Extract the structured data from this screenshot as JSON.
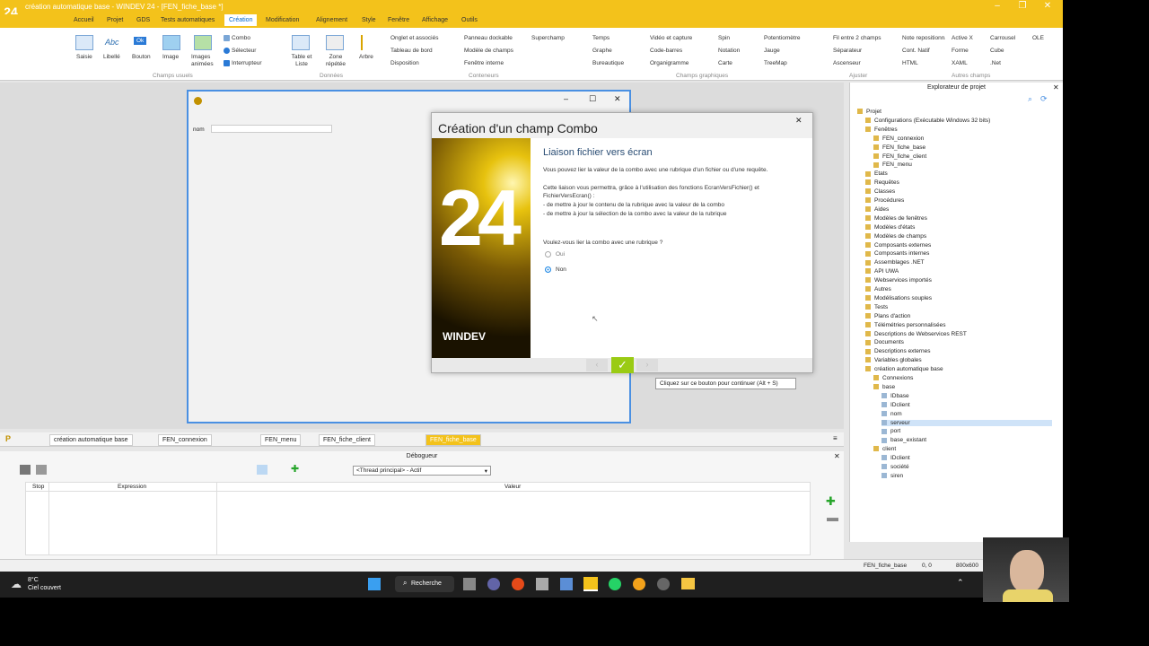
{
  "titlebar": {
    "logo": "24",
    "title": "création automatique base - WINDEV 24 - [FEN_fiche_base *]"
  },
  "menu": [
    "Accueil",
    "Projet",
    "GDS",
    "Tests automatiques",
    "Création",
    "Modification",
    "Alignement",
    "Style",
    "Fenêtre",
    "Affichage",
    "Outils"
  ],
  "menu_active_index": 4,
  "ribbon": {
    "usual": {
      "saisie": "Saisie",
      "libelle": "Libellé",
      "bouton": "Bouton",
      "image": "Image",
      "images_animees": "Images animées",
      "combo": "Combo",
      "selecteur": "Sélecteur",
      "interrupteur": "Interrupteur",
      "abc": "Abc",
      "ok": "Ok"
    },
    "data": {
      "table": "Table et Liste",
      "zone": "Zone répétée",
      "arbre": "Arbre"
    },
    "containers": [
      "Onglet et associés",
      "Tableau de bord",
      "Disposition",
      "Panneau dockable",
      "Modèle de champs",
      "Fenêtre interne",
      "Superchamp"
    ],
    "graphic": [
      "Temps",
      "Graphe",
      "Bureautique",
      "Vidéo et capture",
      "Code-barres",
      "Organigramme",
      "Spin",
      "Notation",
      "Carte",
      "Potentiomètre",
      "Jauge",
      "TreeMap"
    ],
    "adjust": [
      "Fil entre 2 champs",
      "Séparateur",
      "Ascenseur"
    ],
    "other": [
      "Note repositionnable",
      "Cont. Natif",
      "HTML",
      "Active X",
      "Forme",
      "XAML",
      "Carrousel",
      "Cube",
      ".Net",
      "OLE"
    ],
    "groups": {
      "usual": "Champs usuels",
      "data": "Données",
      "containers": "Conteneurs",
      "graphic": "Champs graphiques",
      "adjust": "Ajuster",
      "other": "Autres champs"
    }
  },
  "fen_base": {
    "label_nom": "nom"
  },
  "dialog": {
    "title": "Création d'un champ Combo",
    "heading": "Liaison fichier vers écran",
    "p1": "Vous pouvez lier la valeur de la combo avec une rubrique d'un fichier ou d'une requête.",
    "p2": "Cette liaison vous permettra, grâce à l'utilisation des fonctions EcranVersFichier() et",
    "p3": "FichierVersEcran() :",
    "p4": "- de mettre à jour le contenu de la rubrique avec la valeur de la combo",
    "p5": "- de mettre à jour la sélection de la combo avec la valeur de la rubrique",
    "question": "Voulez-vous lier la combo avec une rubrique ?",
    "opt_yes": "Oui",
    "opt_no": "Non",
    "selected": "Non",
    "splash_number": "24",
    "splash_brand": "WINDEV"
  },
  "tooltip": "Cliquez sur ce bouton pour continuer (Alt + S)",
  "explorer": {
    "title": "Explorateur de projet",
    "items": [
      "Projet",
      "Configurations (Exécutable Windows 32 bits)",
      "Fenêtres",
      "FEN_connexion",
      "FEN_fiche_base",
      "FEN_fiche_client",
      "FEN_menu",
      "Etats",
      "Requêtes",
      "Classes",
      "Procédures",
      "Aides",
      "Modèles de fenêtres",
      "Modèles d'états",
      "Modèles de champs",
      "Composants externes",
      "Composants internes",
      "Assemblages .NET",
      "API UWA",
      "Webservices importés",
      "Autres",
      "Modélisations souples",
      "Tests",
      "Plans d'action",
      "Télémétries personnalisées",
      "Descriptions de Webservices REST",
      "Documents",
      "Descriptions externes",
      "Variables globales",
      "création automatique base",
      "Connexions",
      "base",
      "IDbase",
      "IDclient",
      "nom",
      "serveur",
      "port",
      "base_existant",
      "client",
      "IDclient",
      "société",
      "siren"
    ]
  },
  "tabs": [
    "création automatique base",
    "FEN_connexion",
    "FEN_menu",
    "FEN_fiche_client",
    "FEN_fiche_base"
  ],
  "debugger": {
    "title": "Débogueur",
    "thread": "<Thread principal> - Actif",
    "col_stop": "Stop",
    "col_expr": "Expression",
    "col_val": "Valeur"
  },
  "status": {
    "window": "FEN_fiche_base",
    "coords": "0, 0",
    "size": "800x600"
  },
  "taskbar": {
    "temp": "8°C",
    "weather": "Ciel couvert",
    "search": "Recherche"
  },
  "colors": {
    "accent": "#f3c21b",
    "selection": "#4a90e2"
  }
}
